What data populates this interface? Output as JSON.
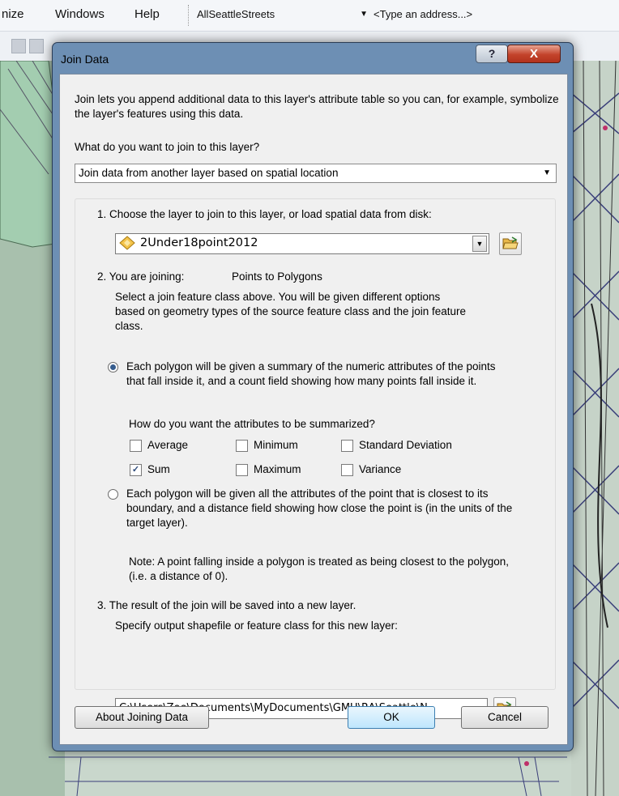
{
  "menubar": {
    "items": [
      "nize",
      "Windows",
      "Help"
    ],
    "layer_combo": "AllSeattleStreets",
    "address_placeholder": "<Type an address...>"
  },
  "dialog": {
    "title": "Join Data",
    "help_label": "?",
    "close_label": "X",
    "intro": "Join lets you append additional data to this layer's attribute table so you can, for example, symbolize the layer's features using this data.",
    "question": "What do you want to join to this layer?",
    "join_type": "Join data from another layer based on spatial location",
    "step1": "1.  Choose the layer to join to this layer, or load spatial data from disk:",
    "join_layer": "2Under18point2012",
    "step2_prefix": "2.  You are joining:",
    "step2_value": "Points to Polygons",
    "step2_desc": "Select a join feature class above.  You will be given different options based on geometry types of the source feature class and the join feature class.",
    "option1": "Each polygon will be given a summary of the numeric attributes of the points that fall inside it, and a count field showing how many points fall inside it.",
    "summarize_question": "How do you want the attributes to be summarized?",
    "checkboxes": [
      {
        "label": "Average",
        "checked": false
      },
      {
        "label": "Minimum",
        "checked": false
      },
      {
        "label": "Standard Deviation",
        "checked": false
      },
      {
        "label": "Sum",
        "checked": true
      },
      {
        "label": "Maximum",
        "checked": false
      },
      {
        "label": "Variance",
        "checked": false
      }
    ],
    "option2": "Each polygon will be given all the attributes of the point that is closest to its boundary, and a distance field showing how close the point is (in the units of the target layer).",
    "note": "Note: A point falling inside a polygon is treated as being closest to the polygon, (i.e. a distance of 0).",
    "step3": "3.  The result of the join will be saved into a new layer.",
    "step3_desc": "Specify output shapefile or feature class for this new layer:",
    "output_path": "C:\\Users\\Zoe\\Documents\\MyDocuments\\GMU\\RA\\Seattle\\N",
    "about_label": "About Joining Data",
    "ok_label": "OK",
    "cancel_label": "Cancel"
  },
  "colors": {
    "dialog_frame": "#6d8fb4",
    "client_bg": "#f0f0f0",
    "map_bg": "#c9d7cc",
    "close_red": "#c3432b"
  }
}
